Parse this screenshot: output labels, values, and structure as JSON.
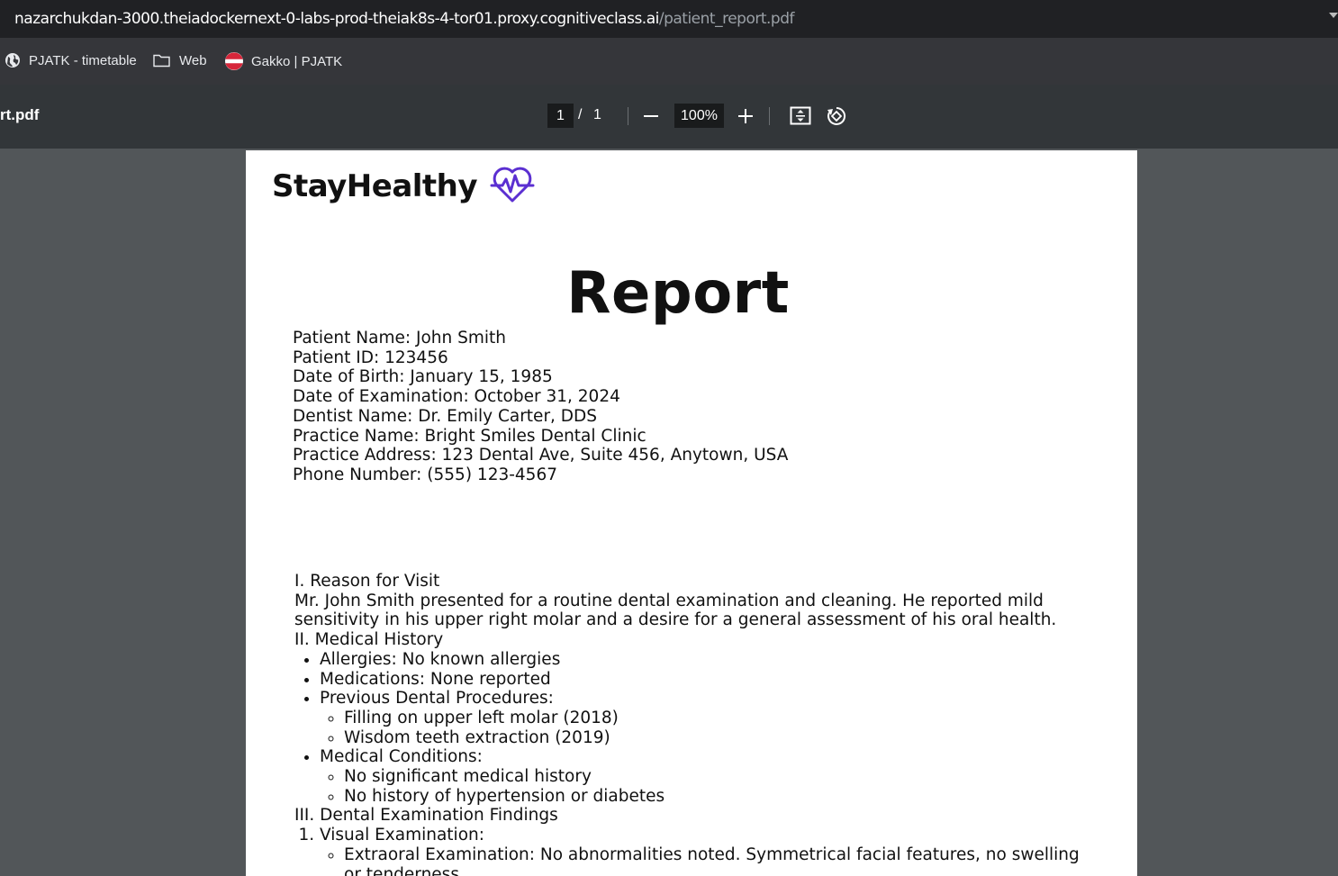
{
  "url": {
    "host": "nazarchukdan-3000.theiadockernext-0-labs-prod-theiak8s-4-tor01.proxy.cognitiveclass.ai",
    "path": "/patient_report.pdf"
  },
  "bookmarks": [
    {
      "label": "PJATK - timetable",
      "icon": "globe-icon"
    },
    {
      "label": "Web",
      "icon": "folder-icon"
    },
    {
      "label": "Gakko | PJATK",
      "icon": "pjatk-logo-icon"
    }
  ],
  "toolbar": {
    "filename": "rt.pdf",
    "page_current": "1",
    "page_sep": "/",
    "page_total": "1",
    "zoom": "100%"
  },
  "document": {
    "brand": "StayHealthy",
    "title": "Report",
    "info": [
      "Patient Name: John Smith",
      "Patient ID: 123456",
      "Date of Birth: January 15, 1985",
      "Date of Examination: October 31, 2024",
      "Dentist Name: Dr. Emily Carter, DDS",
      "Practice Name: Bright Smiles Dental Clinic",
      "Practice Address: 123 Dental Ave, Suite 456, Anytown, USA",
      "Phone Number: (555) 123-4567"
    ],
    "section1_heading": "I. Reason for Visit",
    "section1_text": "Mr. John Smith presented for a routine dental examination and cleaning. He reported mild sensitivity in his upper right molar and a desire for a general assessment of his oral health.",
    "section2_heading": "II. Medical History",
    "allergies": "Allergies: No known allergies",
    "medications": "Medications: None reported",
    "procedures_label": "Previous Dental Procedures:",
    "procedure_1": "Filling on upper left molar (2018)",
    "procedure_2": "Wisdom teeth extraction (2019)",
    "conditions_label": "Medical Conditions:",
    "condition_1": "No significant medical history",
    "condition_2": "No history of hypertension or diabetes",
    "section3_heading": "III. Dental Examination Findings",
    "visual_exam": "Visual Examination:",
    "extraoral": "Extraoral Examination: No abnormalities noted. Symmetrical facial features, no swelling or tenderness."
  },
  "colors": {
    "logo": "#5b2fd1",
    "page_bg": "#ffffff",
    "viewer_bg": "#525659",
    "toolbar_bg": "#323639"
  }
}
